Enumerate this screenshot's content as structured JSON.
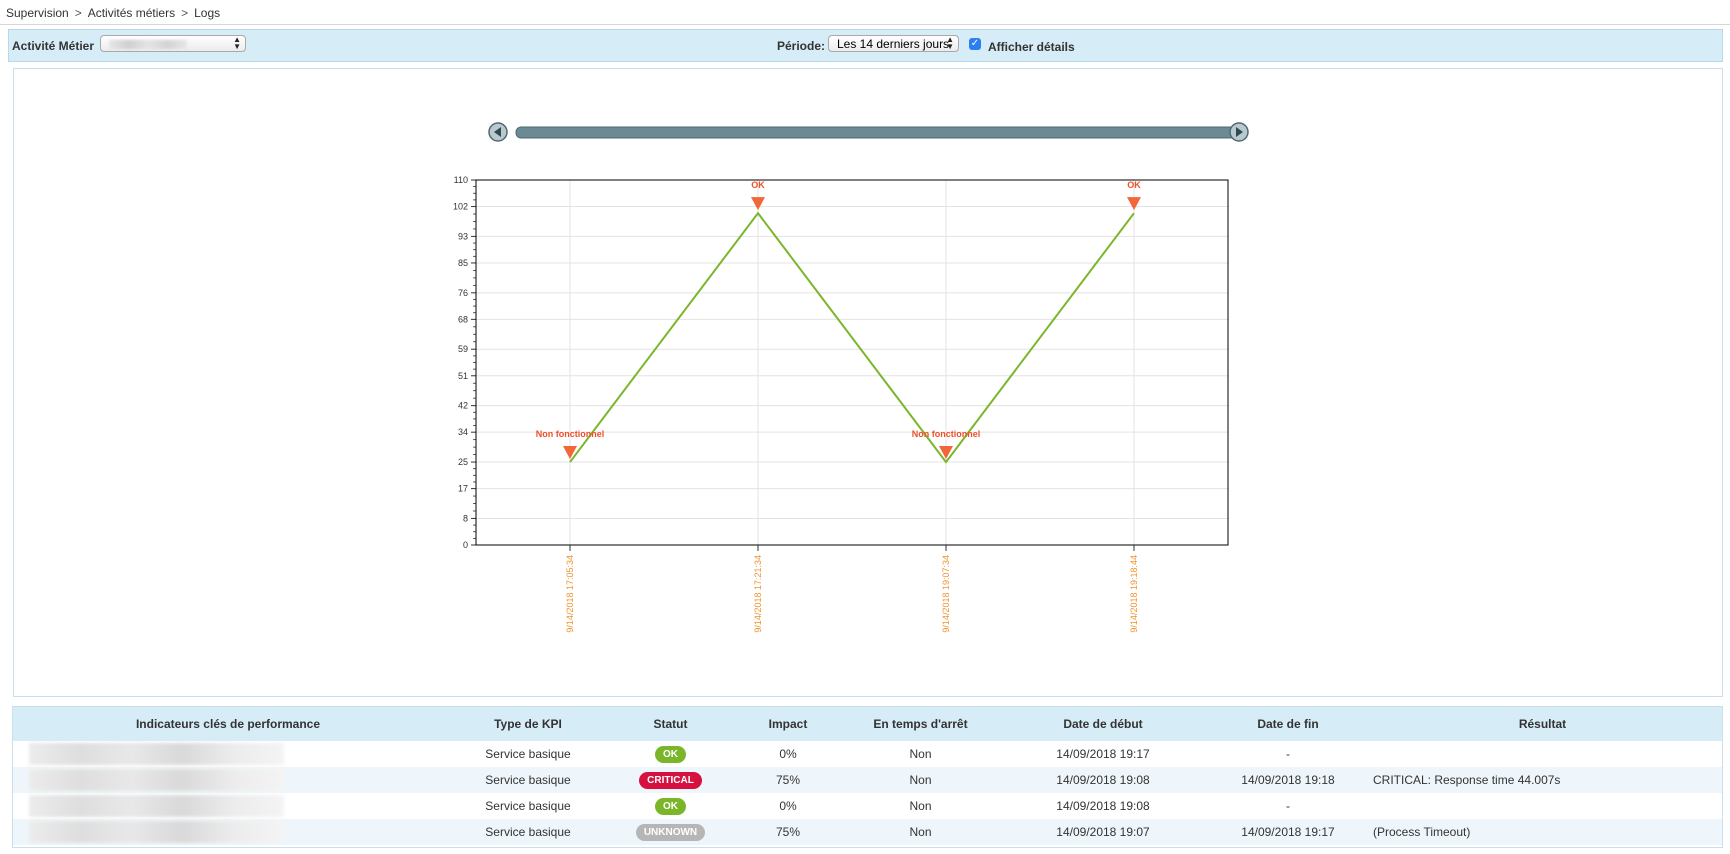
{
  "breadcrumb": [
    "Supervision",
    "Activités métiers",
    "Logs"
  ],
  "toolbar": {
    "activity_label": "Activité Métier",
    "period_label": "Période:",
    "period_value": "Les 14 derniers jours",
    "details_label": "Afficher détails",
    "details_checked": true
  },
  "colors": {
    "toolbar_bg": "#d6ecf7",
    "line": "#7bb62a",
    "marker": "#f2663a",
    "ok": "#7bb62a",
    "critical": "#d6103f",
    "unknown": "#b6b6b6",
    "xlabel": "#f0922c",
    "scrollbar": "#6b8a94"
  },
  "chart_data": {
    "type": "line",
    "title": "",
    "xlabel": "",
    "ylabel": "",
    "x": [
      "9/14/2018 17:05:34",
      "9/14/2018 17:21:34",
      "9/14/2018 19:07:34",
      "9/14/2018 19:18:44"
    ],
    "series": [
      {
        "values": [
          25,
          100,
          25,
          100
        ]
      }
    ],
    "annotations": [
      "Non fonctionnel",
      "OK",
      "Non fonctionnel",
      "OK"
    ],
    "yticks": [
      0,
      8,
      17,
      25,
      34,
      42,
      51,
      59,
      68,
      76,
      85,
      93,
      102,
      110
    ],
    "ylim": [
      0,
      110
    ],
    "grid": true,
    "legend": "none"
  },
  "table": {
    "headers": [
      "Indicateurs clés de performance",
      "Type de KPI",
      "Statut",
      "Impact",
      "En temps d'arrêt",
      "Date de début",
      "Date de fin",
      "Résultat"
    ],
    "rows": [
      {
        "type": "Service basique",
        "status": "OK",
        "status_color": "#7bb62a",
        "impact": "0%",
        "downtime": "Non",
        "start": "14/09/2018 19:17",
        "end": "-",
        "result": ""
      },
      {
        "type": "Service basique",
        "status": "CRITICAL",
        "status_color": "#d6103f",
        "impact": "75%",
        "downtime": "Non",
        "start": "14/09/2018 19:08",
        "end": "14/09/2018 19:18",
        "result": "CRITICAL: Response time 44.007s"
      },
      {
        "type": "Service basique",
        "status": "OK",
        "status_color": "#7bb62a",
        "impact": "0%",
        "downtime": "Non",
        "start": "14/09/2018 19:08",
        "end": "-",
        "result": ""
      },
      {
        "type": "Service basique",
        "status": "UNKNOWN",
        "status_color": "#b6b6b6",
        "impact": "75%",
        "downtime": "Non",
        "start": "14/09/2018 19:07",
        "end": "14/09/2018 19:17",
        "result": "(Process Timeout)"
      }
    ]
  }
}
